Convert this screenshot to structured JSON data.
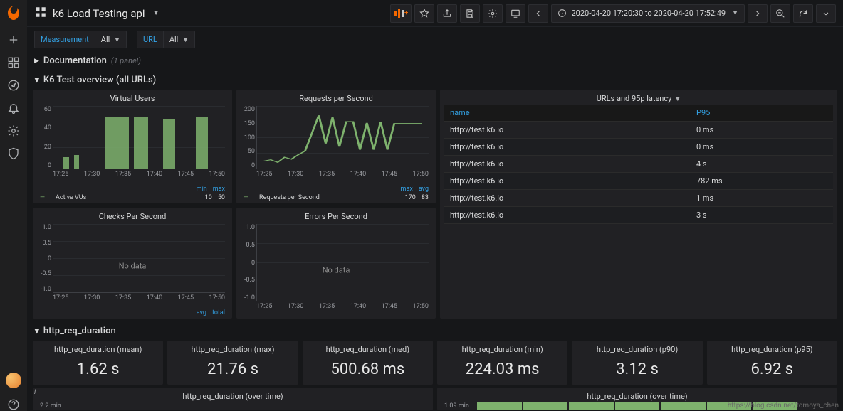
{
  "header": {
    "title": "k6 Load Testing api",
    "time_range": "2020-04-20 17:20:30 to 2020-04-20 17:52:49"
  },
  "variables": {
    "measurement_label": "Measurement",
    "measurement_value": "All",
    "url_label": "URL",
    "url_value": "All"
  },
  "rows": {
    "documentation": {
      "title": "Documentation",
      "count": "(1 panel)"
    },
    "overview": {
      "title": "K6 Test overview (all URLs)"
    },
    "http_req_duration": {
      "title": "http_req_duration"
    }
  },
  "panels": {
    "virtual_users": {
      "title": "Virtual Users",
      "x_ticks": [
        "17:25",
        "17:30",
        "17:35",
        "17:40",
        "17:45",
        "17:50"
      ],
      "legend_head": [
        "min",
        "max"
      ],
      "legend_row": {
        "name": "Active VUs",
        "min": "10",
        "max": "50"
      }
    },
    "rps": {
      "title": "Requests per Second",
      "x_ticks": [
        "17:25",
        "17:30",
        "17:35",
        "17:40",
        "17:45",
        "17:50"
      ],
      "legend_head": [
        "max",
        "avg"
      ],
      "legend_row": {
        "name": "Requests per Second",
        "max": "170",
        "avg": "83"
      }
    },
    "urls_p95": {
      "title": "URLs and 95p latency",
      "cols": {
        "name": "name",
        "p95": "P95"
      },
      "rows": [
        {
          "name": "http://test.k6.io",
          "p95": "0 ms"
        },
        {
          "name": "http://test.k6.io",
          "p95": "0 ms"
        },
        {
          "name": "http://test.k6.io",
          "p95": "4 s"
        },
        {
          "name": "http://test.k6.io",
          "p95": "782 ms"
        },
        {
          "name": "http://test.k6.io",
          "p95": "1 ms"
        },
        {
          "name": "http://test.k6.io",
          "p95": "3 s"
        }
      ]
    },
    "checks": {
      "title": "Checks Per Second",
      "nodata": "No data",
      "y_ticks": [
        "1.0",
        "0.5",
        "0",
        "-0.5",
        "-1.0"
      ],
      "x_ticks": [
        "17:25",
        "17:30",
        "17:35",
        "17:40",
        "17:45",
        "17:50"
      ],
      "legend_head": [
        "avg",
        "total"
      ]
    },
    "errors": {
      "title": "Errors Per Second",
      "nodata": "No data",
      "y_ticks": [
        "1.0",
        "0.5",
        "0",
        "-0.5",
        "-1.0"
      ],
      "x_ticks": [
        "17:25",
        "17:30",
        "17:35",
        "17:40",
        "17:45",
        "17:50"
      ]
    },
    "singlestats": [
      {
        "title": "http_req_duration (mean)",
        "value": "1.62 s"
      },
      {
        "title": "http_req_duration (max)",
        "value": "21.76 s"
      },
      {
        "title": "http_req_duration (med)",
        "value": "500.68 ms"
      },
      {
        "title": "http_req_duration (min)",
        "value": "224.03 ms"
      },
      {
        "title": "http_req_duration (p90)",
        "value": "3.12 s"
      },
      {
        "title": "http_req_duration (p95)",
        "value": "6.92 s"
      }
    ],
    "over_time_1": {
      "title": "http_req_duration (over time)",
      "ylabel": "2.2 min"
    },
    "over_time_2": {
      "title": "http_req_duration (over time)",
      "ylabel": "1.09 min"
    }
  },
  "chart_data": [
    {
      "type": "bar",
      "panel": "virtual_users",
      "ylabel": "",
      "ylim": [
        0,
        60
      ],
      "y_ticks": [
        0,
        20,
        40,
        60
      ],
      "x_ticks": [
        "17:25",
        "17:30",
        "17:35",
        "17:40",
        "17:45",
        "17:50"
      ],
      "series": [
        {
          "name": "Active VUs",
          "values": [
            10,
            12,
            50,
            50,
            50,
            0,
            48,
            0,
            50,
            0
          ]
        }
      ]
    },
    {
      "type": "line",
      "panel": "rps",
      "ylim": [
        0,
        200
      ],
      "y_ticks": [
        0,
        50,
        100,
        150,
        200
      ],
      "x_ticks": [
        "17:25",
        "17:30",
        "17:35",
        "17:40",
        "17:45",
        "17:50"
      ],
      "series": [
        {
          "name": "Requests per Second",
          "values": [
            25,
            30,
            20,
            40,
            35,
            55,
            170,
            80,
            165,
            70,
            150,
            150,
            60,
            145,
            60,
            150,
            60,
            140
          ]
        }
      ]
    }
  ],
  "watermark": "https://blog.csdn.net/tomoya_chen"
}
